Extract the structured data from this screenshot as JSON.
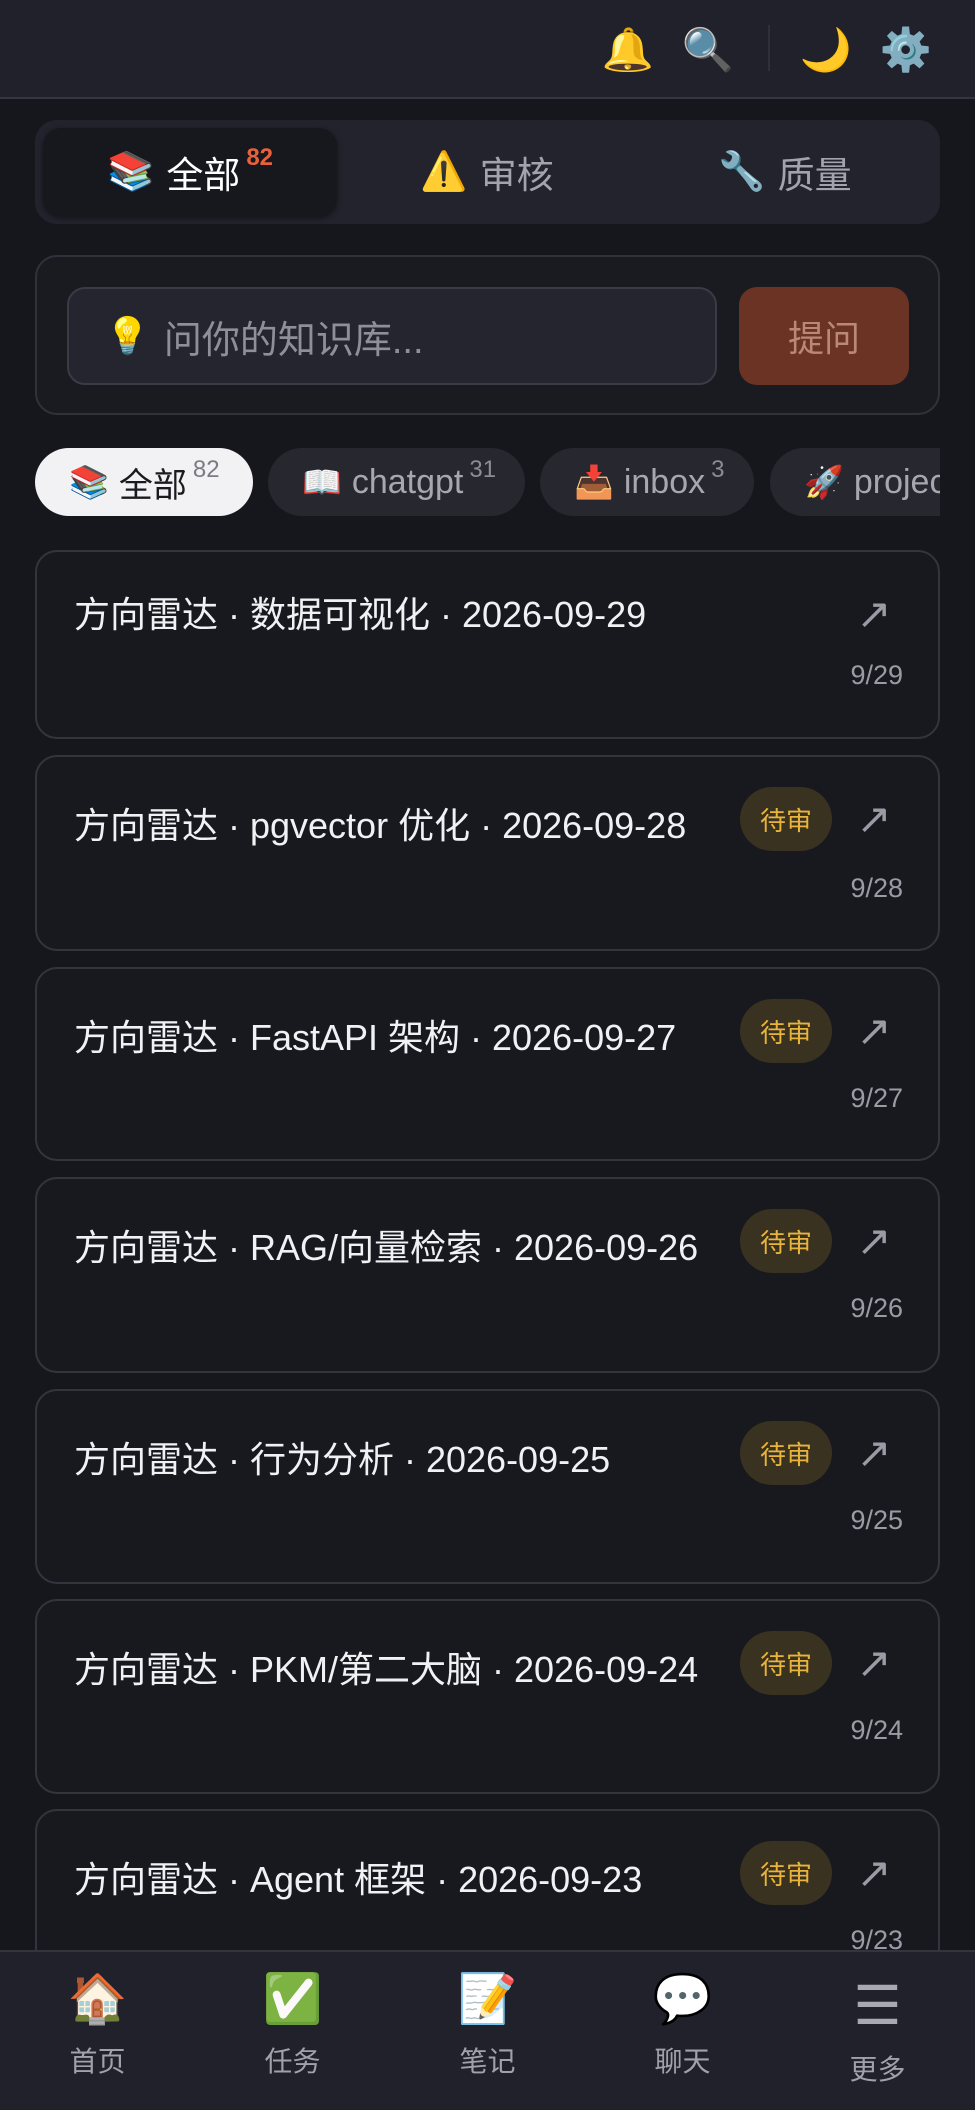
{
  "topbar": {
    "icons": [
      {
        "name": "bell-icon",
        "glyph": "🔔"
      },
      {
        "name": "search-icon",
        "glyph": "🔍"
      },
      {
        "name": "moon-icon",
        "glyph": "🌙"
      },
      {
        "name": "gear-icon",
        "glyph": "⚙️"
      }
    ]
  },
  "segment": {
    "tabs": [
      {
        "emoji": "📚",
        "label": "全部",
        "count": "82"
      },
      {
        "emoji": "⚠️",
        "label": "审核"
      },
      {
        "emoji": "🔧",
        "label": "质量"
      }
    ]
  },
  "ask": {
    "emoji": "💡",
    "placeholder": "问你的知识库...",
    "button": "提问"
  },
  "filters": [
    {
      "emoji": "📚",
      "label": "全部",
      "count": "82"
    },
    {
      "emoji": "📖",
      "label": "chatgpt",
      "count": "31"
    },
    {
      "emoji": "📥",
      "label": "inbox",
      "count": "3"
    },
    {
      "emoji": "🚀",
      "label": "projects"
    }
  ],
  "cards": [
    {
      "title": "方向雷达 · 数据可视化 · 2026-09-29",
      "badge": "",
      "arrow": "↗",
      "date": "9/29"
    },
    {
      "title": "方向雷达 · pgvector 优化 · 2026-09-28",
      "badge": "待审",
      "arrow": "↗",
      "date": "9/28"
    },
    {
      "title": "方向雷达 · FastAPI 架构 · 2026-09-27",
      "badge": "待审",
      "arrow": "↗",
      "date": "9/27"
    },
    {
      "title": "方向雷达 · RAG/向量检索 · 2026-09-26",
      "badge": "待审",
      "arrow": "↗",
      "date": "9/26"
    },
    {
      "title": "方向雷达 · 行为分析 · 2026-09-25",
      "badge": "待审",
      "arrow": "↗",
      "date": "9/25"
    },
    {
      "title": "方向雷达 · PKM/第二大脑 · 2026-09-24",
      "badge": "待审",
      "arrow": "↗",
      "date": "9/24"
    },
    {
      "title": "方向雷达 · Agent 框架 · 2026-09-23",
      "badge": "待审",
      "arrow": "↗",
      "date": "9/23"
    }
  ],
  "nav": [
    {
      "icon": "🏠",
      "label": "首页"
    },
    {
      "icon": "✅",
      "label": "任务"
    },
    {
      "icon": "📝",
      "label": "笔记"
    },
    {
      "icon": "💬",
      "label": "聊天"
    },
    {
      "icon": "☰",
      "label": "更多"
    }
  ],
  "colors": {
    "background": "#16171c",
    "accent_count": "#e8613a",
    "ask_button": "#6a3324",
    "badge_bg": "#3a3220",
    "badge_text": "#e8b43a"
  }
}
